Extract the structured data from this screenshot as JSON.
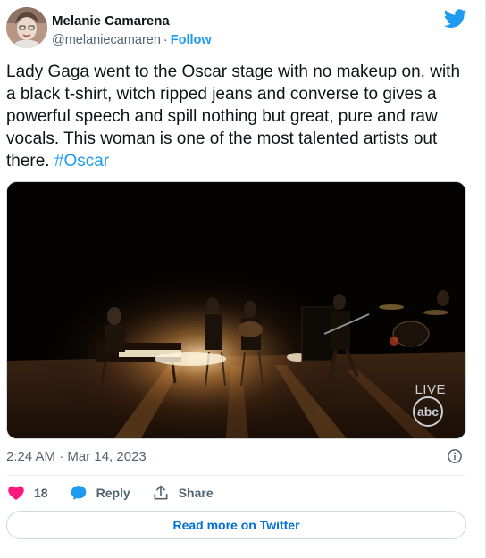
{
  "author": {
    "display_name": "Melanie Camarena",
    "handle": "@melaniecamaren",
    "separator": "·",
    "follow_label": "Follow"
  },
  "tweet": {
    "text": "Lady Gaga went to the Oscar stage with no makeup on, with a black t-shirt, witch ripped jeans and converse to gives a powerful speech and spill nothing but great, pure and raw vocals. This woman is one of the most talented artists out there. ",
    "hashtag": "#Oscar",
    "timestamp": "2:24 AM · Mar 14, 2023"
  },
  "media": {
    "live_label": "LIVE",
    "network_logo": "abc"
  },
  "actions": {
    "like_count": "18",
    "reply_label": "Reply",
    "share_label": "Share"
  },
  "read_more_label": "Read more on Twitter",
  "icons": {
    "brand": "twitter-bird-icon",
    "info": "info-icon",
    "like": "heart-icon",
    "reply": "speech-bubble-icon",
    "share": "share-upload-icon"
  },
  "colors": {
    "twitter_blue": "#1d9bf0",
    "like_pink": "#f91880",
    "text": "#0f1419",
    "secondary_text": "#536471"
  }
}
